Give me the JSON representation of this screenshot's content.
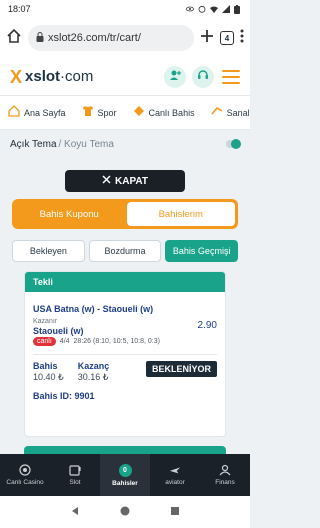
{
  "status_bar": {
    "time": "18:07"
  },
  "browser": {
    "url": "xslot26.com/tr/cart/",
    "tab_count": "4"
  },
  "header": {
    "logo_x": "X",
    "logo_text": "xslot",
    "logo_suffix": "·com"
  },
  "nav": {
    "items": [
      "Ana Sayfa",
      "Spor",
      "Canlı Bahis",
      "Sanal"
    ]
  },
  "theme": {
    "light": "Açık Tema",
    "dark": "/ Koyu Tema"
  },
  "close_button": {
    "label": "KAPAT"
  },
  "coupon_tabs": {
    "active": "Bahis Kuponu",
    "inactive": "Bahislerim"
  },
  "sub_tabs": [
    "Bekleyen",
    "Bozdurma",
    "Bahis Geçmişi"
  ],
  "bet": {
    "type": "Tekli",
    "match": "USA Batna (w) - Staoueli (w)",
    "odds": "2.90",
    "market": "Kazanır",
    "pick": "Staoueli (w)",
    "live_label": "canlı",
    "period": "4/4",
    "score": "28:26 (8:10, 10:5, 10:8, 0:3)",
    "stake_label": "Bahis",
    "stake_value": "10.40 ₺",
    "win_label": "Kazanç",
    "win_value": "30.16 ₺",
    "status": "BEKLENİYOR",
    "bet_id": "Bahis ID: 9901"
  },
  "bottom_nav": {
    "items": [
      "Canlı Casino",
      "Slot",
      "Bahisler",
      "aviator",
      "Finans"
    ],
    "badge": "0"
  },
  "colors": {
    "accent": "#f39a1d",
    "teal": "#1aa38b",
    "dark": "#1b2027"
  }
}
